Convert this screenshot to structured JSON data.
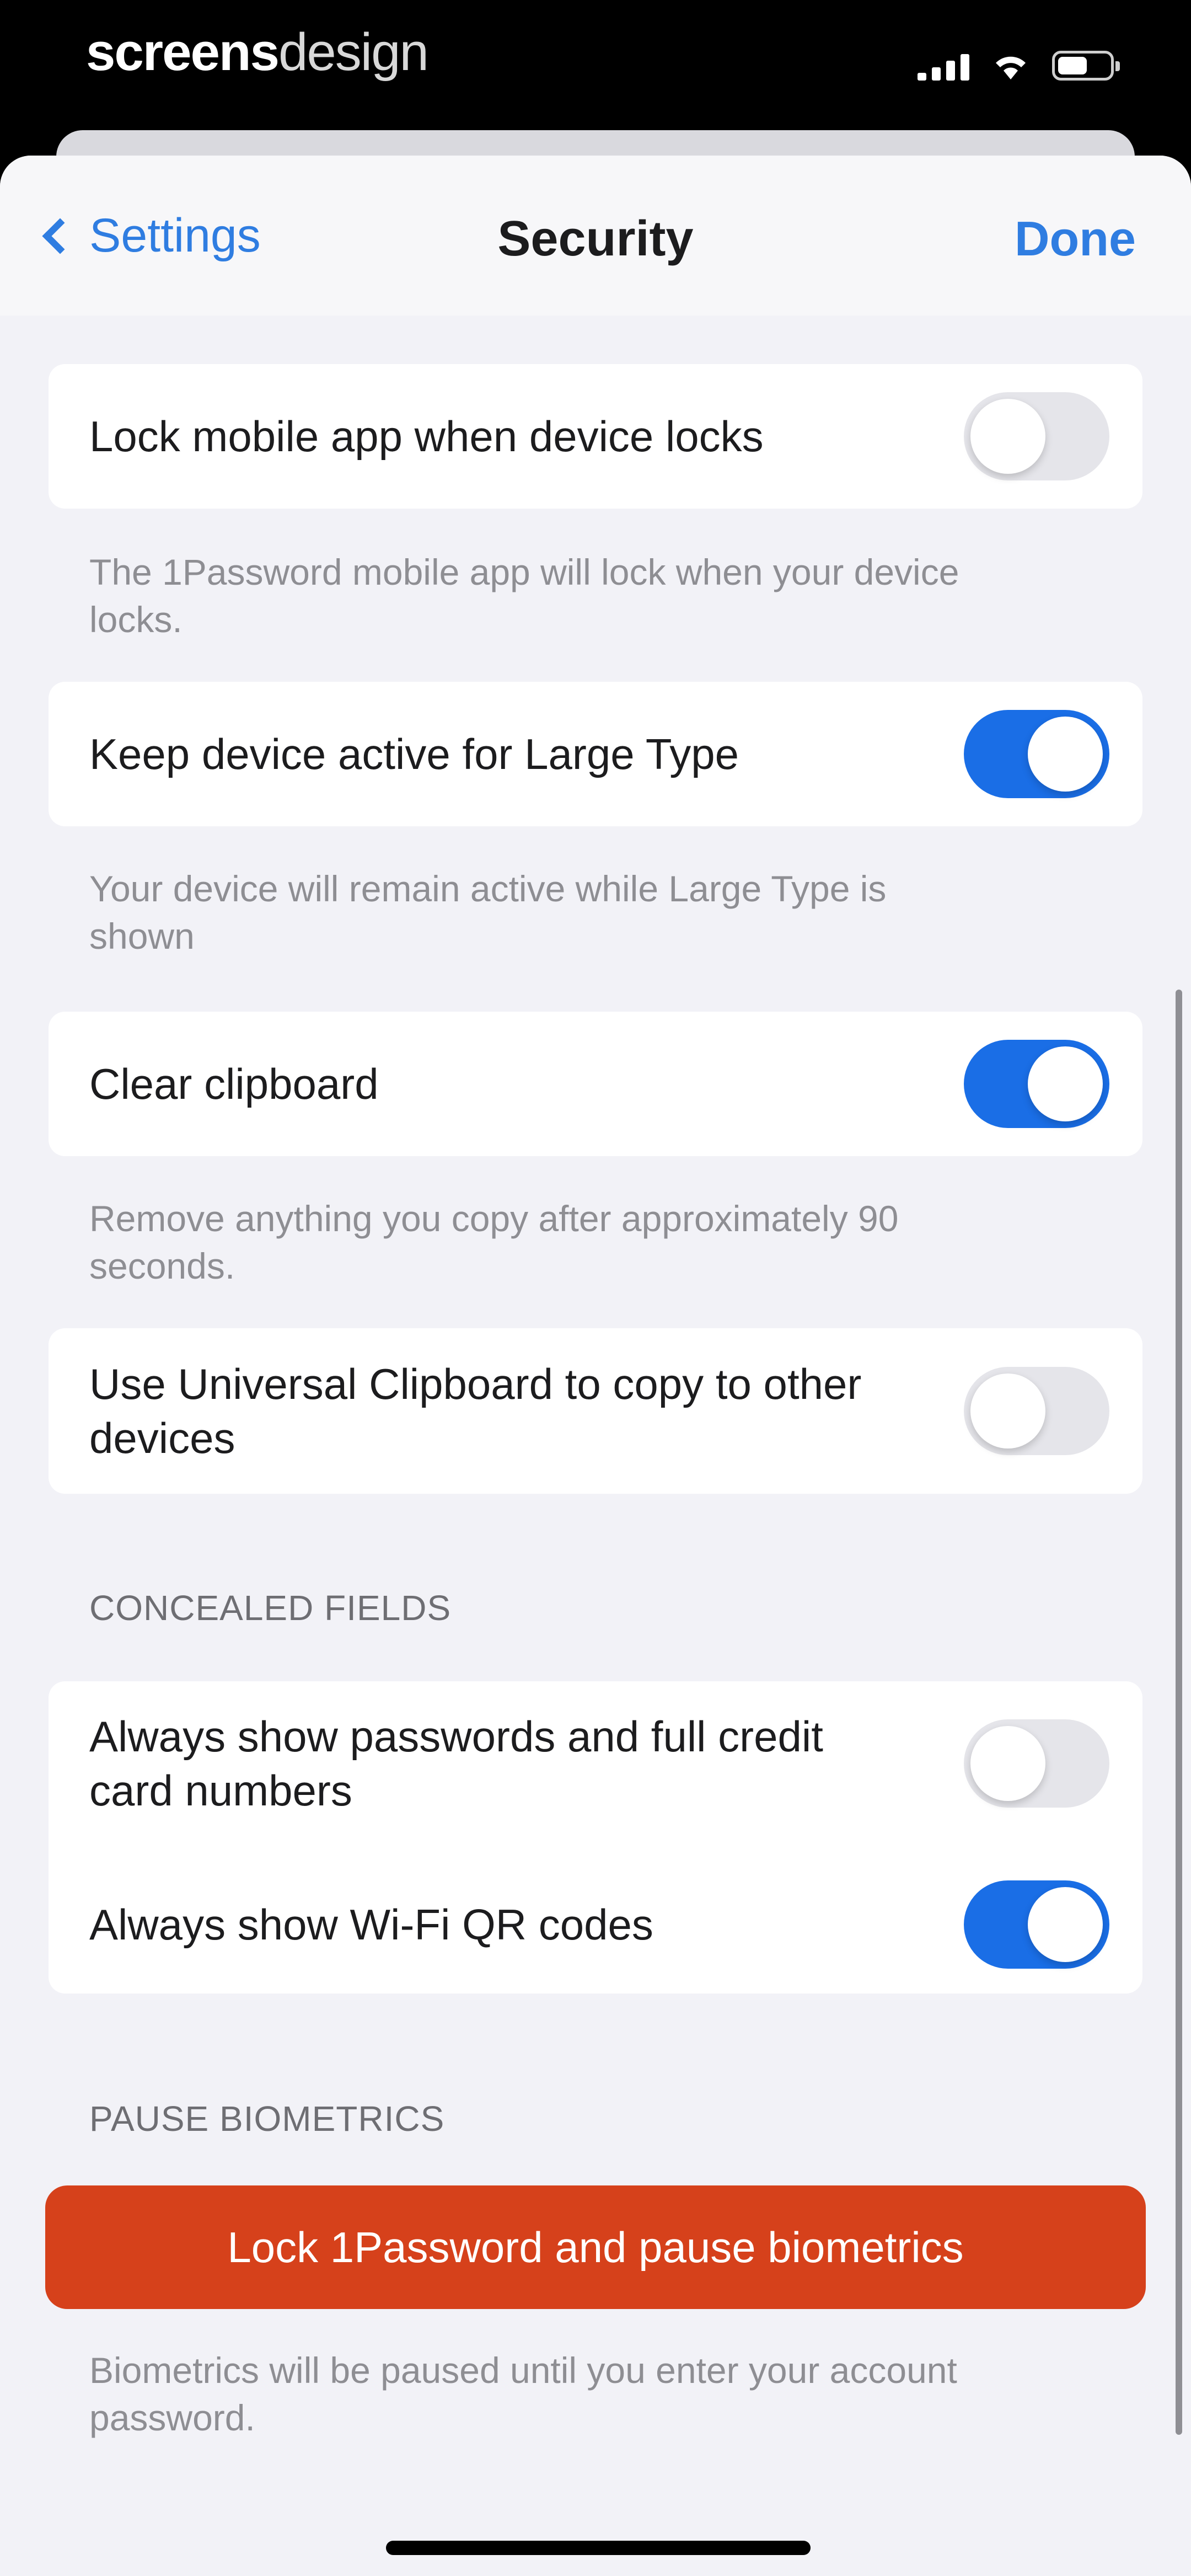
{
  "status_bar": {
    "brand_bold": "screens",
    "brand_light": "design",
    "icons": [
      "signal-icon",
      "wifi-icon",
      "battery-icon"
    ]
  },
  "nav": {
    "back_label": "Settings",
    "title": "Security",
    "done_label": "Done"
  },
  "settings": {
    "lock_on_device_lock": {
      "label": "Lock mobile app when device locks",
      "enabled": false,
      "footnote": "The 1Password mobile app will lock when your device locks."
    },
    "keep_active_large_type": {
      "label": "Keep device active for Large Type",
      "enabled": true,
      "footnote": "Your device will remain active while Large Type is shown"
    },
    "clear_clipboard": {
      "label": "Clear clipboard",
      "enabled": true,
      "footnote": "Remove anything you copy after approximately 90 seconds."
    },
    "universal_clipboard": {
      "label": "Use Universal Clipboard to copy to other devices",
      "enabled": false
    }
  },
  "concealed_fields": {
    "header": "CONCEALED FIELDS",
    "always_show_passwords": {
      "label": "Always show passwords and full credit card numbers",
      "enabled": false
    },
    "always_show_wifi_qr": {
      "label": "Always show Wi-Fi QR codes",
      "enabled": true
    }
  },
  "pause_biometrics": {
    "header": "PAUSE BIOMETRICS",
    "button_label": "Lock 1Password and pause biometrics",
    "footnote": "Biometrics will be paused until you enter your account password."
  },
  "colors": {
    "accent": "#2f7de1",
    "toggle_on": "#1a6ee6",
    "toggle_off": "#e5e5ea",
    "destructive": "#d6411b",
    "background": "#f2f2f7"
  }
}
